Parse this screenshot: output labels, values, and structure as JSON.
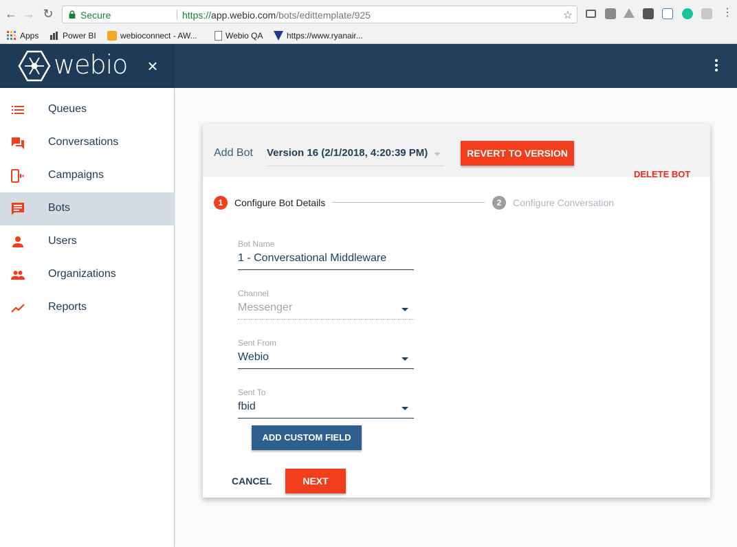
{
  "browser": {
    "secure_label": "Secure",
    "url_scheme": "https://",
    "url_host": "app.webio.com",
    "url_path": "/bots/edittemplate/925",
    "bookmarks": [
      {
        "label": "Apps",
        "icon": "apps-grid-icon"
      },
      {
        "label": "Power BI",
        "icon": "powerbi-icon"
      },
      {
        "label": "webioconnect - AW...",
        "icon": "aws-cube-icon"
      },
      {
        "label": "Webio QA",
        "icon": "page-icon"
      },
      {
        "label": "https://www.ryanair...",
        "icon": "ryanair-icon"
      }
    ]
  },
  "header": {
    "logo_text": "webio",
    "close_icon": "×"
  },
  "sidebar": {
    "items": [
      {
        "label": "Queues",
        "icon": "list-icon",
        "active": false
      },
      {
        "label": "Conversations",
        "icon": "chat-bubbles-icon",
        "active": false
      },
      {
        "label": "Campaigns",
        "icon": "phone-vibrate-icon",
        "active": false
      },
      {
        "label": "Bots",
        "icon": "message-icon",
        "active": true
      },
      {
        "label": "Users",
        "icon": "person-icon",
        "active": false
      },
      {
        "label": "Organizations",
        "icon": "people-icon",
        "active": false
      },
      {
        "label": "Reports",
        "icon": "trending-icon",
        "active": false
      }
    ]
  },
  "card": {
    "add_bot_label": "Add Bot",
    "version_select": "Version 16 (2/1/2018, 4:20:39 PM)",
    "revert_label": "REVERT TO VERSION",
    "delete_label": "DELETE BOT",
    "steps": [
      {
        "num": "1",
        "label": "Configure Bot Details",
        "active": true
      },
      {
        "num": "2",
        "label": "Configure Conversation",
        "active": false
      }
    ],
    "fields": {
      "bot_name": {
        "label": "Bot Name",
        "value": "1 - Conversational Middleware"
      },
      "channel": {
        "label": "Channel",
        "value": "Messenger"
      },
      "sent_from": {
        "label": "Sent From",
        "value": "Webio"
      },
      "sent_to": {
        "label": "Sent To",
        "value": "fbid"
      }
    },
    "add_custom_field_label": "ADD CUSTOM FIELD",
    "cancel_label": "CANCEL",
    "next_label": "NEXT"
  },
  "colors": {
    "brand_navy": "#22405c",
    "accent_orange": "#f23e1c",
    "secondary_blue": "#2f5f8f"
  }
}
